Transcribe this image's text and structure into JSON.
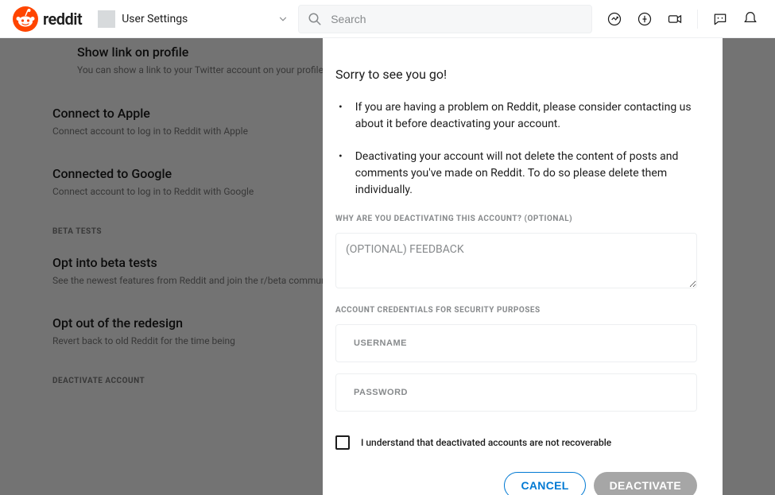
{
  "header": {
    "logo_text": "reddit",
    "nav_label": "User Settings",
    "search_placeholder": "Search"
  },
  "bg": {
    "sections": [
      {
        "title": "Show link on profile",
        "sub": "You can show a link to your Twitter account on your profile",
        "indented": true
      },
      {
        "title": "Connect to Apple",
        "sub": "Connect account to log in to Reddit with Apple"
      },
      {
        "title": "Connected to Google",
        "sub": "Connect account to log in to Reddit with Google"
      }
    ],
    "beta_category": "Beta Tests",
    "beta_sections": [
      {
        "title": "Opt into beta tests",
        "sub": "See the newest features from Reddit and join the r/beta community"
      },
      {
        "title": "Opt out of the redesign",
        "sub": "Revert back to old Reddit for the time being"
      }
    ],
    "deactivate_category": "Deactivate Account"
  },
  "modal": {
    "title": "Sorry to see you go!",
    "bullet1": "If you are having a problem on Reddit, please consider contacting us about it before deactivating your account.",
    "bullet2": "Deactivating your account will not delete the content of posts and comments you've made on Reddit. To do so please delete them individually.",
    "reason_label": "Why are you deactivating this account? (Optional)",
    "reason_placeholder": "(OPTIONAL) FEEDBACK",
    "creds_label": "Account credentials for security purposes",
    "username_placeholder": "USERNAME",
    "password_placeholder": "PASSWORD",
    "checkbox_label": "I understand that deactivated accounts are not recoverable",
    "cancel_label": "CANCEL",
    "deactivate_label": "DEACTIVATE"
  }
}
